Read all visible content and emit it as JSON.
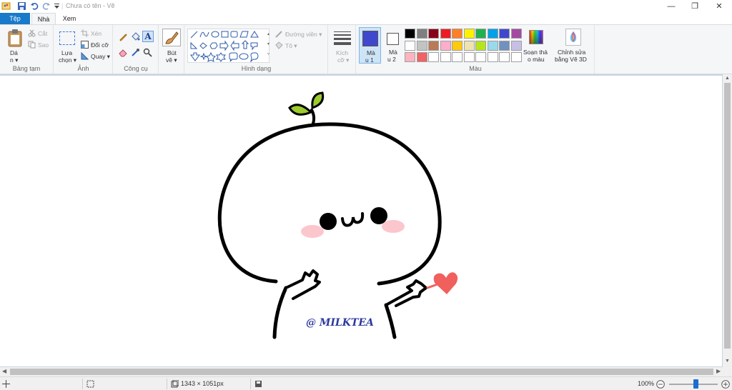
{
  "window": {
    "title": "Chưa có tên - Vẽ",
    "minimize": "—",
    "maximize": "❐",
    "close": "✕"
  },
  "tabs": {
    "file": "Tệp",
    "home": "Nhà",
    "view": "Xem"
  },
  "clipboard": {
    "paste_label": "Dá",
    "paste_label2": "n ▾",
    "cut": "Cắt",
    "copy": "Sao",
    "group": "Bảng tạm"
  },
  "image": {
    "select_label": "Lựa",
    "select_label2": "chọn ▾",
    "crop": "Xén",
    "resize": "Đổi cỡ",
    "rotate": "Quay ▾",
    "group": "Ảnh"
  },
  "tools": {
    "group": "Công cụ",
    "text_tool": "A"
  },
  "brushes": {
    "label": "Bút",
    "label2": "vẽ ▾"
  },
  "shapes": {
    "outline": "Đường viền ▾",
    "fill": "Tô ▾",
    "group": "Hình dạng"
  },
  "size": {
    "label": "Kích",
    "label2": "cỡ ▾"
  },
  "colors": {
    "color1": "Mà",
    "color1b": "u 1",
    "color2": "Mà",
    "color2b": "u 2",
    "edit": "Soạn thả",
    "edit2": "o màu",
    "paint3d": "Chỉnh sửa",
    "paint3d2": "bằng Vẽ 3D",
    "group": "Màu",
    "primary_color": "#3f48cc",
    "secondary_color": "#ffffff",
    "palette": [
      "#000000",
      "#7f7f7f",
      "#880015",
      "#ed1c24",
      "#ff7f27",
      "#fff200",
      "#22b14c",
      "#00a2e8",
      "#3f48cc",
      "#a349a4",
      "#ffffff",
      "#c3c3c3",
      "#b97a57",
      "#ffaec9",
      "#ffc90e",
      "#efe4b0",
      "#b5e61d",
      "#99d9ea",
      "#7092be",
      "#c8bfe7",
      "#ffb3c1",
      "#f06263",
      "#ffffff",
      "#ffffff",
      "#ffffff",
      "#ffffff",
      "#ffffff",
      "#ffffff",
      "#ffffff",
      "#ffffff"
    ]
  },
  "canvas": {
    "watermark": "@ MILKTEA",
    "heart_color": "#f0605d",
    "cheek_color": "#fbbcc4",
    "sprout_color": "#9ccb2e"
  },
  "status": {
    "size": "1343 × 1051px",
    "zoom": "100%",
    "zoom_fraction": 0.55
  }
}
